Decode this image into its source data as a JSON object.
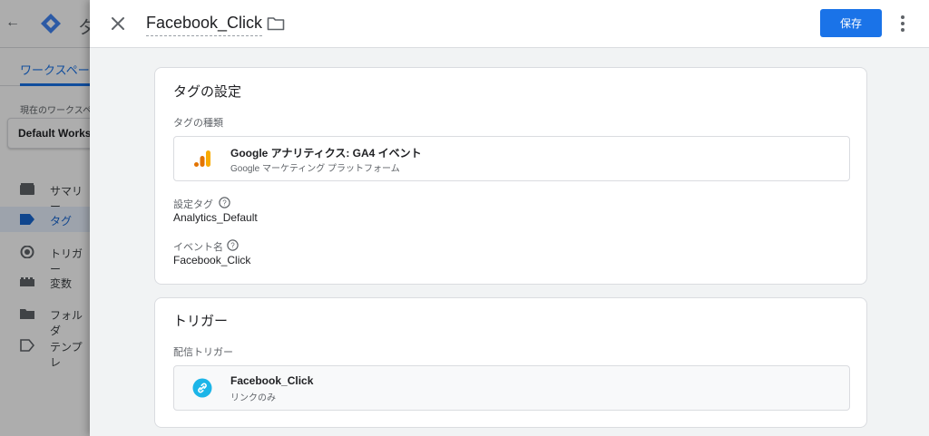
{
  "background": {
    "app_title": "タ",
    "tab": "ワークスペー",
    "workspace_label": "現在のワークスペ",
    "workspace_name": "Default Works",
    "nav": [
      {
        "label": "サマリー",
        "icon": "summary-icon"
      },
      {
        "label": "タグ",
        "icon": "tag-icon",
        "active": true
      },
      {
        "label": "トリガー",
        "icon": "trigger-icon"
      },
      {
        "label": "変数",
        "icon": "variables-icon"
      },
      {
        "label": "フォルダ",
        "icon": "folder-icon"
      },
      {
        "label": "テンプレ",
        "icon": "template-icon"
      }
    ]
  },
  "header": {
    "tag_name": "Facebook_Click",
    "save_label": "保存"
  },
  "tag_config": {
    "title": "タグの設定",
    "type_label": "タグの種類",
    "type_name": "Google アナリティクス: GA4 イベント",
    "type_vendor": "Google マーケティング プラットフォーム",
    "config_tag_label": "設定タグ",
    "config_tag_value": "Analytics_Default",
    "event_name_label": "イベント名",
    "event_name_value": "Facebook_Click"
  },
  "triggering": {
    "title": "トリガー",
    "firing_label": "配信トリガー",
    "trigger_name": "Facebook_Click",
    "trigger_type": "リンクのみ"
  },
  "colors": {
    "primary": "#1a73e8",
    "ga_orange": "#f9ab00",
    "ga_dark_orange": "#e37400",
    "link_trigger": "#1cb5e8"
  }
}
